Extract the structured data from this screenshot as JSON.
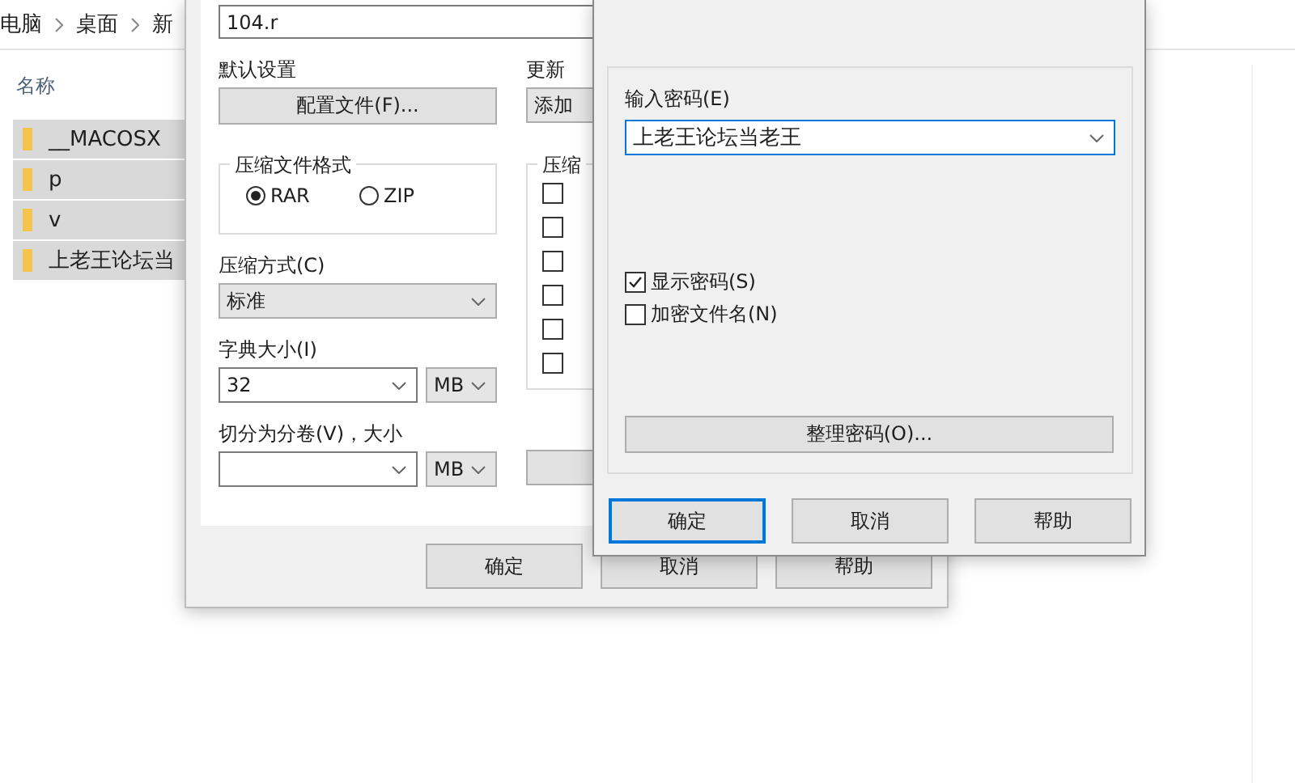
{
  "explorer": {
    "breadcrumb": [
      "电脑",
      "桌面",
      "新"
    ],
    "column_header": "名称",
    "items": [
      {
        "name": "__MACOSX",
        "selected": true
      },
      {
        "name": "p",
        "selected": true
      },
      {
        "name": "v",
        "selected": true
      },
      {
        "name": "上老王论坛当",
        "selected": true
      }
    ]
  },
  "archive_dialog": {
    "filename": "104.r",
    "default_settings_label": "默认设置",
    "profiles_button": "配置文件(F)...",
    "update_label": "更新",
    "update_value": "添加",
    "format_group": {
      "title": "压缩文件格式",
      "options": [
        {
          "label": "RAR",
          "selected": true
        },
        {
          "label": "ZIP",
          "selected": false
        }
      ]
    },
    "options_group": {
      "title": "压缩",
      "checkboxes": [
        {
          "checked": false
        },
        {
          "checked": false
        },
        {
          "checked": false
        },
        {
          "checked": false
        },
        {
          "checked": false
        },
        {
          "checked": false
        }
      ]
    },
    "method": {
      "label": "压缩方式(C)",
      "value": "标准"
    },
    "dictionary": {
      "label": "字典大小(I)",
      "value": "32",
      "unit": "MB"
    },
    "split": {
      "label": "切分为分卷(V)，大小",
      "unit": "MB"
    },
    "buttons": [
      "确定",
      "取消",
      "帮助"
    ]
  },
  "password_dialog": {
    "label": "输入密码(E)",
    "value": "上老王论坛当老王",
    "checkboxes": [
      {
        "label": "显示密码(S)",
        "checked": true
      },
      {
        "label": "加密文件名(N)",
        "checked": false
      }
    ],
    "organize_button": "整理密码(O)...",
    "buttons": [
      {
        "label": "确定",
        "default": true
      },
      {
        "label": "取消",
        "default": false
      },
      {
        "label": "帮助",
        "default": false
      }
    ]
  }
}
